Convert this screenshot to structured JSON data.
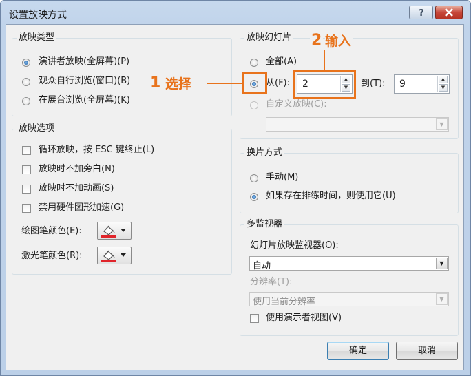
{
  "window": {
    "title": "设置放映方式"
  },
  "show_type": {
    "title": "放映类型",
    "options": [
      {
        "label": "演讲者放映(全屏幕)(P)",
        "checked": true
      },
      {
        "label": "观众自行浏览(窗口)(B)",
        "checked": false
      },
      {
        "label": "在展台浏览(全屏幕)(K)",
        "checked": false
      }
    ]
  },
  "show_options": {
    "title": "放映选项",
    "checks": [
      {
        "label": "循环放映，按 ESC 键终止(L)"
      },
      {
        "label": "放映时不加旁白(N)"
      },
      {
        "label": "放映时不加动画(S)"
      },
      {
        "label": "禁用硬件图形加速(G)"
      }
    ],
    "pen_color_label": "绘图笔颜色(E):",
    "laser_color_label": "激光笔颜色(R):"
  },
  "slides": {
    "title": "放映幻灯片",
    "all_label": "全部(A)",
    "from_label": "从(F):",
    "from_value": "2",
    "to_label": "到(T):",
    "to_value": "9",
    "custom_label": "自定义放映(C):"
  },
  "advance": {
    "title": "换片方式",
    "manual_label": "手动(M)",
    "timings_label": "如果存在排练时间，则使用它(U)"
  },
  "monitors": {
    "title": "多监视器",
    "monitor_label": "幻灯片放映监视器(O):",
    "monitor_value": "自动",
    "resolution_label": "分辨率(T):",
    "resolution_value": "使用当前分辨率",
    "presenter_view_label": "使用演示者视图(V)"
  },
  "annotations": {
    "step1_num": "1",
    "step1_text": "选择",
    "step2_num": "2",
    "step2_text": "输入",
    "color": "#e8731c"
  },
  "buttons": {
    "ok": "确定",
    "cancel": "取消"
  }
}
